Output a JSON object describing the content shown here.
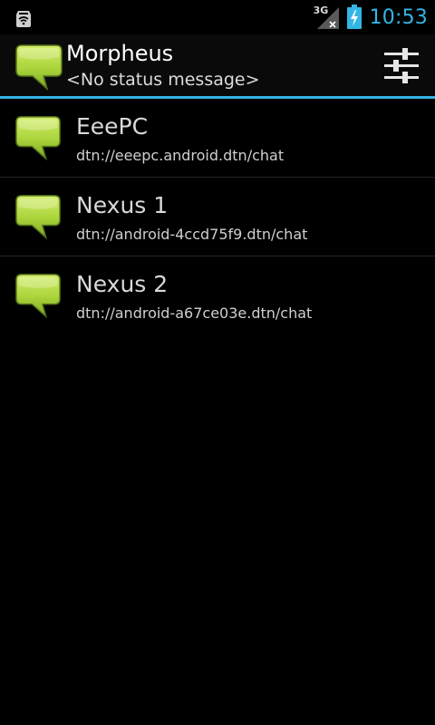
{
  "status_bar": {
    "network_label": "3G",
    "time": "10:53",
    "accent_color": "#33b5e5"
  },
  "header": {
    "title": "Morpheus",
    "status_message": "<No status message>",
    "icon": "chat-bubble-icon",
    "settings_icon": "sliders-icon"
  },
  "buddies": [
    {
      "name": "EeePC",
      "address": "dtn://eeepc.android.dtn/chat"
    },
    {
      "name": "Nexus 1",
      "address": "dtn://android-4ccd75f9.dtn/chat"
    },
    {
      "name": "Nexus 2",
      "address": "dtn://android-a67ce03e.dtn/chat"
    }
  ]
}
